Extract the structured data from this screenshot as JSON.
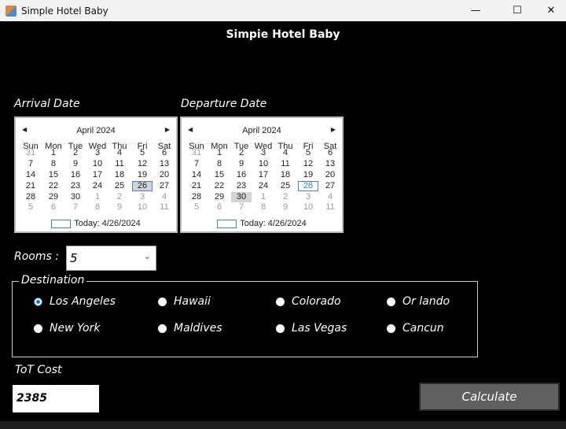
{
  "window": {
    "title": "Simple Hotel Baby",
    "minimize": "—",
    "maximize": "☐",
    "close": "✕"
  },
  "header": {
    "title": "Simpie Hotel Baby"
  },
  "arrival": {
    "label": "Arrival Date",
    "month": "April 2024",
    "today": "Today: 4/26/2024",
    "selected": 26,
    "today_day": 26
  },
  "departure": {
    "label": "Departure Date",
    "month": "April 2024",
    "today": "Today: 4/26/2024",
    "selected": 30,
    "today_day": 26
  },
  "calendar": {
    "weekdays": [
      "Sun",
      "Mon",
      "Tue",
      "Wed",
      "Thu",
      "Fri",
      "Sat"
    ],
    "weeks": [
      [
        31,
        1,
        2,
        3,
        4,
        5,
        6
      ],
      [
        7,
        8,
        9,
        10,
        11,
        12,
        13
      ],
      [
        14,
        15,
        16,
        17,
        18,
        19,
        20
      ],
      [
        21,
        22,
        23,
        24,
        25,
        26,
        27
      ],
      [
        28,
        29,
        30,
        1,
        2,
        3,
        4
      ],
      [
        5,
        6,
        7,
        8,
        9,
        10,
        11
      ]
    ]
  },
  "rooms": {
    "label": "Rooms :",
    "value": "5"
  },
  "destination": {
    "label": "Destination",
    "selected": "Los Angeles",
    "options": [
      "Los Angeles",
      "Hawaii",
      "Colorado",
      "Or lando",
      "New York",
      "Maldives",
      "Las Vegas",
      "Cancun"
    ]
  },
  "cost": {
    "label": "ToT Cost",
    "value": "2385"
  },
  "calculate": {
    "label": "Calculate"
  }
}
